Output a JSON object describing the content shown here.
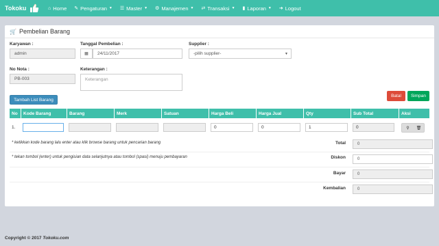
{
  "nav": {
    "brand": "Tokoku",
    "items": [
      {
        "label": "Home",
        "icon": "home-icon",
        "caret": false
      },
      {
        "label": "Pengaturan",
        "icon": "wrench-icon",
        "caret": true
      },
      {
        "label": "Master",
        "icon": "list-icon",
        "caret": true
      },
      {
        "label": "Manajemen",
        "icon": "cogs-icon",
        "caret": true
      },
      {
        "label": "Transaksi",
        "icon": "exchange-icon",
        "caret": true
      },
      {
        "label": "Laporan",
        "icon": "book-icon",
        "caret": true
      },
      {
        "label": "Logout",
        "icon": "signout-icon",
        "caret": false
      }
    ]
  },
  "panel": {
    "title": "Pembelian Barang"
  },
  "form": {
    "karyawan_label": "Karyawan :",
    "karyawan_value": "admin",
    "tanggal_label": "Tanggal Pembelian :",
    "tanggal_value": "24/11/2017",
    "supplier_label": "Supplier :",
    "supplier_value": "-pilih supplier-",
    "nonota_label": "No Nota :",
    "nonota_value": "PB-003",
    "keterangan_label": "Keterangan :",
    "keterangan_placeholder": "Keterangan"
  },
  "buttons": {
    "tambah": "Tambah List Barang",
    "batal": "Batal",
    "simpan": "Simpan"
  },
  "table": {
    "headers": [
      "No",
      "Kode Barang",
      "Barang",
      "Merk",
      "Satuan",
      "Harga Beli",
      "Harga Jual",
      "Qty",
      "Sub Total",
      "Aksi"
    ],
    "row": {
      "no": "1.",
      "kode": "",
      "barang": "",
      "merk": "",
      "satuan": "",
      "harga_beli": "0",
      "harga_jual": "0",
      "qty": "1",
      "subtotal": "0"
    }
  },
  "notes": {
    "note1": "* ketikkan kode barang lalu enter atau klik browse barang untuk pencarian barang",
    "note2": "* tekan tombol (enter) untuk pengisian data selanjutnya atau tombol (spasi) menuju pembayaran"
  },
  "summary": {
    "total_label": "Total",
    "total_value": "0",
    "diskon_label": "Diskon",
    "diskon_value": "0",
    "bayar_label": "Bayar",
    "bayar_value": "0",
    "kembalian_label": "Kembalian",
    "kembalian_value": "0"
  },
  "footer": {
    "prefix": "Copyright © 2017",
    "site": "Tokoku.com"
  },
  "colors": {
    "navbar": "#3fbfaa",
    "primary": "#3c8dbc",
    "danger": "#dd4b39",
    "success": "#00a65a",
    "background": "#d2d6de"
  }
}
